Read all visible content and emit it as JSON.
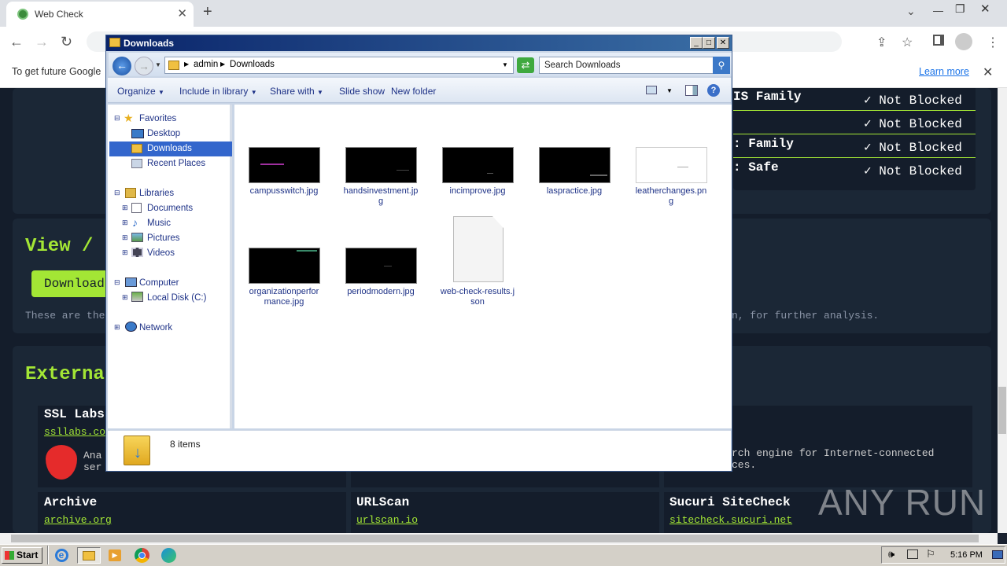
{
  "browser": {
    "tab_title": "Web Check",
    "infobar_text": "To get future Google",
    "infobar_link": "Learn more"
  },
  "webpage": {
    "dns_rows": [
      {
        "name": "IS Family",
        "status": "Not Blocked"
      },
      {
        "name": "",
        "status": "Not Blocked"
      },
      {
        "name": ": Family",
        "status": "Not Blocked"
      },
      {
        "name": ": Safe",
        "status": "Not Blocked"
      }
    ],
    "view_heading": "View / E",
    "download_button": "Download",
    "description_left": "These are the",
    "description_right": "n, for further analysis.",
    "external_heading": "External",
    "cards": [
      {
        "title": "SSL Labs",
        "link": "ssllabs.co",
        "desc": "Ana\nser"
      },
      {
        "title": "",
        "link": "",
        "desc": "rch engine for Internet-connected\nces."
      },
      {
        "title": "Archive",
        "link": "archive.org"
      },
      {
        "title": "URLScan",
        "link": "urlscan.io"
      },
      {
        "title": "Sucuri SiteCheck",
        "link": "sitecheck.sucuri.net"
      }
    ],
    "watermark": "ANY RUN"
  },
  "explorer": {
    "title": "Downloads",
    "breadcrumb": [
      "admin",
      "Downloads"
    ],
    "search_placeholder": "Search Downloads",
    "commands": [
      "Organize",
      "Include in library",
      "Share with",
      "Slide show",
      "New folder"
    ],
    "tree": {
      "favorites": "Favorites",
      "fav_items": [
        "Desktop",
        "Downloads",
        "Recent Places"
      ],
      "libraries": "Libraries",
      "lib_items": [
        "Documents",
        "Music",
        "Pictures",
        "Videos"
      ],
      "computer": "Computer",
      "comp_items": [
        "Local Disk (C:)"
      ],
      "network": "Network"
    },
    "files": [
      {
        "name": "campusswitch.jpg",
        "type": "dark"
      },
      {
        "name": "handsinvestment.jpg",
        "type": "dark"
      },
      {
        "name": "incimprove.jpg",
        "type": "dark"
      },
      {
        "name": "laspractice.jpg",
        "type": "dark"
      },
      {
        "name": "leatherchanges.png",
        "type": "light"
      },
      {
        "name": "organizationperformance.jpg",
        "type": "dark"
      },
      {
        "name": "periodmodern.jpg",
        "type": "dark"
      },
      {
        "name": "web-check-results.json",
        "type": "doc"
      }
    ],
    "status_text": "8 items"
  },
  "taskbar": {
    "start": "Start",
    "clock": "5:16 PM"
  }
}
